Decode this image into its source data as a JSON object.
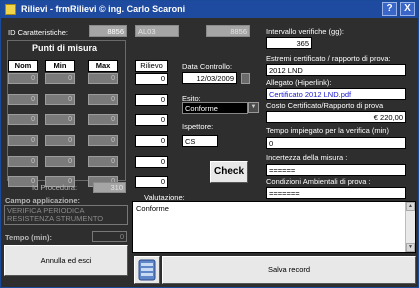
{
  "window": {
    "title": "Rilievi  -  frmRilievi © ing. Carlo Scaroni",
    "help": "?",
    "close": "X"
  },
  "id_car": {
    "label": "ID Caratteristiche:",
    "value": "8856"
  },
  "top_ghost": {
    "code": "AL03",
    "value": "8856"
  },
  "punti": {
    "title": "Punti di misura",
    "headers": [
      "Nom",
      "Min",
      "Max"
    ],
    "rows": [
      [
        "0",
        "0",
        "0"
      ],
      [
        "0",
        "0",
        "0"
      ],
      [
        "0",
        "0",
        "0"
      ],
      [
        "0",
        "0",
        "0"
      ],
      [
        "0",
        "0",
        "0"
      ],
      [
        "0",
        "0",
        "0"
      ]
    ]
  },
  "rilievo": {
    "header": "Rilievo",
    "values": [
      "0",
      "0",
      "0",
      "0",
      "0",
      "0"
    ]
  },
  "data_controllo": {
    "label": "Data Controllo:",
    "value": "12/03/2009"
  },
  "esito": {
    "label": "Esito:",
    "value": "Conforme"
  },
  "ispettore": {
    "label": "Ispettore:",
    "value": "CS"
  },
  "check_label": "Check",
  "id_procedura": {
    "label": "Id Procedura:",
    "value": "310"
  },
  "campo_app": {
    "label": "Campo applicazione:",
    "line1": "VERIFICA PERIODICA",
    "line2": "RESISTENZA STRUMENTO"
  },
  "tempo": {
    "label": "Tempo (min):",
    "value": "0"
  },
  "annulla_label": "Annulla ed esci",
  "intervallo": {
    "label": "Intervallo verifiche (gg):",
    "value": "365"
  },
  "estremi": {
    "label": "Estremi certificato / rapporto di prova:",
    "value": "2012 LND"
  },
  "allegato": {
    "label": "Allegato (Hiperlink):",
    "value": "Certificato 2012 LND.pdf"
  },
  "costo": {
    "label": "Costo Certificato/Rapporto di prova",
    "value": "€ 220,00"
  },
  "tempo_verifica": {
    "label": "Tempo impiegato per la verifica (min)",
    "value": "0"
  },
  "incertezza": {
    "label": "Incertezza della misura :",
    "value": "======"
  },
  "condizioni": {
    "label": "Condizioni Ambientali di prova :",
    "value": "======="
  },
  "valutazione": {
    "label": "Valutazione:",
    "value": "Conforme"
  },
  "salva_label": "Salva record"
}
